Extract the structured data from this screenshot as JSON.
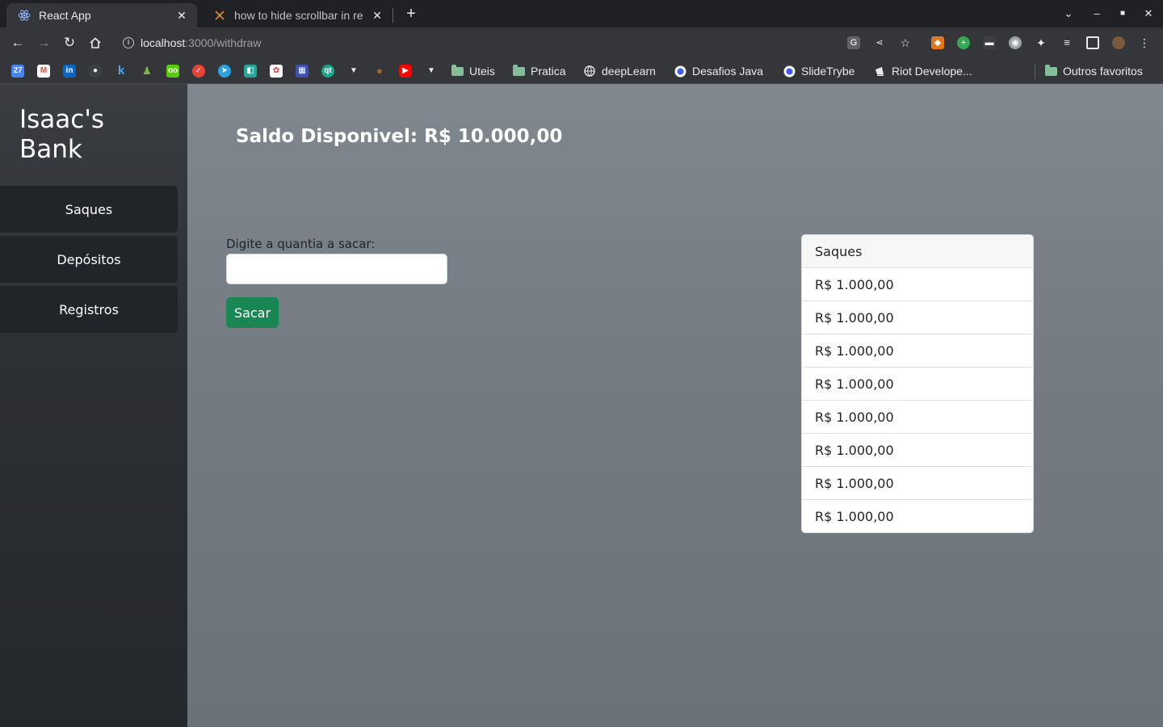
{
  "browser": {
    "tabs": [
      {
        "title": "React App",
        "icon": "react-icon",
        "active": true
      },
      {
        "title": "how to hide scrollbar in re",
        "icon": "stackoverflow-icon",
        "active": false
      }
    ],
    "url_host": "localhost",
    "url_path": ":3000/withdraw",
    "bookmarks": [
      {
        "label": "Uteis",
        "icon": "folder-icon"
      },
      {
        "label": "Pratica",
        "icon": "folder-icon"
      },
      {
        "label": "deepLearn",
        "icon": "globe-icon"
      },
      {
        "label": "Desafios Java",
        "icon": "circle-logo-icon"
      },
      {
        "label": "SlideTrybe",
        "icon": "circle-logo-icon"
      },
      {
        "label": "Riot Develope...",
        "icon": "riot-icon"
      }
    ],
    "other_bookmarks": "Outros favoritos"
  },
  "sidebar": {
    "brand_line1": "Isaac's",
    "brand_line2": "Bank",
    "items": [
      {
        "label": "Saques"
      },
      {
        "label": "Depósitos"
      },
      {
        "label": "Registros"
      }
    ]
  },
  "main": {
    "balance": "Saldo Disponivel: R$ 10.000,00",
    "amount_label": "Digite a quantia a sacar:",
    "amount_value": "",
    "submit_label": "Sacar"
  },
  "withdrawals": {
    "header": "Saques",
    "items": [
      "R$ 1.000,00",
      "R$ 1.000,00",
      "R$ 1.000,00",
      "R$ 1.000,00",
      "R$ 1.000,00",
      "R$ 1.000,00",
      "R$ 1.000,00",
      "R$ 1.000,00"
    ]
  },
  "colors": {
    "sidebar_button": "#212529",
    "accent_success": "#198754",
    "main_bg": "#757b83"
  }
}
